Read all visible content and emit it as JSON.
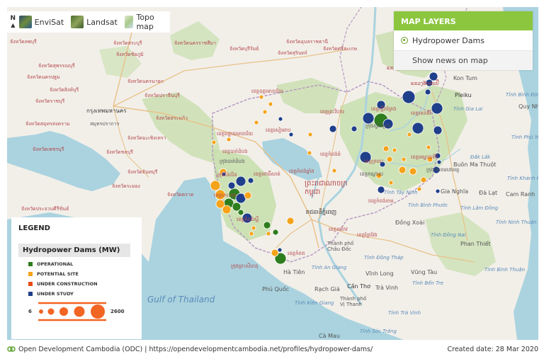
{
  "basemaps": [
    {
      "label": "EnviSat",
      "icon": "envisat-thumbnail"
    },
    {
      "label": "Landsat",
      "icon": "landsat-thumbnail"
    },
    {
      "label": "Topo map",
      "icon": "topo-thumbnail"
    }
  ],
  "north_label": "N",
  "layers_panel": {
    "title": "MAP LAYERS",
    "layer": "Hydropower Dams",
    "news": "Show news on map"
  },
  "legend": {
    "title": "LEGEND",
    "subtitle": "Hydropower Dams (MW)",
    "items": [
      {
        "label": "OPERATIONAL",
        "color": "#2e7d1e"
      },
      {
        "label": "POTENTIAL SITE",
        "color": "#f5a31a"
      },
      {
        "label": "UNDER CONSTRUCTION",
        "color": "#e84c1a"
      },
      {
        "label": "UNDER STUDY",
        "color": "#1f3f8a"
      }
    ],
    "scale_min": "6",
    "scale_max": "2600",
    "scale_color": "#f26522"
  },
  "footer": {
    "source": "Open Development Cambodia (ODC) | https://opendevelopmentcambodia.net/profiles/hydropower-dams/",
    "date": "Created date: 28 Mar 2020"
  },
  "map_labels": {
    "gulf": "Gulf of Thailand",
    "bangkok": "กรุงเทพมหานคร",
    "phnom_penh": "រាជធានីភ្នំពេញ",
    "cambodia": "ព្រះរាជាណាចក្រ\nកម្ពុជា",
    "ha_tien": "Hà Tiên",
    "phu_quoc": "Phú Quốc",
    "rach_gia": "Rạch Giá",
    "can_tho": "Cần Thơ",
    "vinh_long": "Vĩnh Long",
    "tra_vinh": "Trà Vinh",
    "vung_tau": "Vũng Tàu",
    "phan_thiet": "Phan Thiết",
    "pleiku": "Pleiku",
    "kon_tum": "Kon Tum",
    "quy_nhon": "Quy Nhơn",
    "buon_ma_thuot": "Buôn Ma Thuột",
    "gia_nghia": "Gia Nghĩa",
    "da_lat": "Đà Lạt",
    "cam_ranh": "Cam Ranh",
    "dong_xoai": "Đồng Xoài",
    "thanh_pho_chau_doc": "Thành phố Châu Đốc",
    "thanh_pho_vi_thanh": "Thành phố Vị Thanh",
    "ca_mau": "Cà Mau",
    "tinh_gia_lai": "Tỉnh Gia Lai",
    "tinh_binh_dinh": "Tỉnh Bình Định",
    "tinh_phu_yen": "Tỉnh Phú Yên",
    "dak_lak": "Đắk Lắk",
    "tinh_khanh_hoa": "Tỉnh Khánh Hòa",
    "tinh_ninh_thuan": "Tỉnh Ninh Thuận",
    "tinh_binh_thuan": "Tỉnh Bình Thuận",
    "tinh_lam_dong": "Tỉnh Lâm Đồng",
    "tinh_dong_nai": "Tỉnh Đồng Nai",
    "tinh_binh_phuoc": "Tỉnh Bình Phước",
    "tinh_kien_giang": "Tỉnh Kiên Giang",
    "tinh_soc_trang": "Tỉnh Sóc Trăng",
    "tinh_tra_vinh": "Tỉnh Trà Vinh",
    "tinh_ben_tre": "Tỉnh Bến Tre",
    "tinh_tay_ninh": "Tỉnh Tây Ninh",
    "tinh_an_giang": "Tỉnh An Giang",
    "tinh_dong_thap": "Tỉnh Đồng Tháp",
    "kon_tum_prov": "Tỉnh Kon Tum",
    "binh_dinh_city": "Bình Định",
    "lam_dong": "Tỉnh Lâm Đồng",
    "samut_prakan": "สมุทรปราการ",
    "th1": "จังหวัดลพบุรี",
    "th2": "จังหวัดสระบุรี",
    "th3": "จังหวัดนครนายก",
    "th4": "จังหวัดปราจีนบุรี",
    "th5": "จังหวัดสระแก้ว",
    "th6": "จังหวัดฉะเชิงเทรา",
    "th7": "จังหวัดชลบุรี",
    "th8": "จังหวัดระยอง",
    "th9": "จังหวัดจันทบุรี",
    "th10": "จังหวัดตราด",
    "th11": "จังหวัดนครราชสีมา",
    "th12": "จังหวัดบุรีรัมย์",
    "th13": "จังหวัดสุรินทร์",
    "th14": "จังหวัดศรีสะเกษ",
    "th15": "จังหวัดอุบลราชธานี",
    "th16": "จังหวัดอุดรธานี",
    "th17": "จังหวัดชัยภูมิ",
    "th18": "จังหวัดสุพรรณบุรี",
    "th19": "จังหวัดนครปฐม",
    "th20": "จังหวัดราชบุรี",
    "th21": "จังหวัดเพชรบุรี",
    "th22": "จังหวัดประจวบคีรีขันธ์",
    "th23": "จังหวัดสิงห์บุรี",
    "th24": "จังหวัดสมุทรสงคราม",
    "kh1": "ខេត្តឧត្តរមានជ័យ",
    "kh2": "ខេត្តព្រះវិហារ",
    "kh3": "ខេត្តស្ទឹងត្រែង",
    "kh4": "ខេត្តរតនគិរី",
    "kh5": "ខេត្តមណ្ឌលគិរី",
    "kh6": "ខេត្តក្រចេះ",
    "kh7": "ខេត្តកំពង់ធំ",
    "kh8": "ខេត្តសៀមរាប",
    "kh9": "ខេត្តបន្ទាយមានជ័យ",
    "kh10": "ខេត្តបាត់ដំបង",
    "kh11": "ក្រុងប៉ៃលិន",
    "kh12": "ខេត្តពោធិ៍សាត់",
    "kh13": "ខេត្តកំពង់ឆ្នាំង",
    "kh14": "ខេត្តកំពង់ស្ពឺ",
    "kh15": "ខេត្តកោះកុង",
    "kh16": "ខេត្តកំពត",
    "kh17": "ខេត្តតាកែវ",
    "kh18": "ខេត្តព្រៃវែង",
    "kh19": "ខេត្តស្វាយរៀង",
    "kh20": "ខេត្តកំពង់ចាម",
    "kh21": "ខេត្តត្បូងឃ្មុំ",
    "kh22": "ក្រុងព្រះសីហនុ",
    "kh23": "ខេត្តកែប",
    "kh24": "ក្រុងសែនមនោរម្យ",
    "kh25": "ក្រុងបាត់ដំបង",
    "kh26": "ក្រុងស្ទឹងត្រែង",
    "kh27": "ខេត្តកណ្ដាល",
    "la1": "ແຂວງຈຳປາສັກ",
    "la2": "ແຂວງອັດຕະປື",
    "la3": "ແຂວງເຊກອງ",
    "la4": "ແຂວງສາລະວັນ"
  },
  "dams": [
    {
      "s": "study",
      "c": [
        577,
        137
      ],
      "r": 9
    },
    {
      "s": "study",
      "c": [
        606,
        117
      ],
      "r": 5
    },
    {
      "s": "study",
      "c": [
        612,
        108
      ],
      "r": 6
    },
    {
      "s": "study",
      "c": [
        604,
        130
      ],
      "r": 4
    },
    {
      "s": "study",
      "c": [
        617,
        153
      ],
      "r": 8
    },
    {
      "s": "study",
      "c": [
        590,
        181
      ],
      "r": 8
    },
    {
      "s": "study",
      "c": [
        618,
        184
      ],
      "r": 6
    },
    {
      "s": "op",
      "c": [
        538,
        170
      ],
      "r": 10
    },
    {
      "s": "study",
      "c": [
        520,
        167
      ],
      "r": 8
    },
    {
      "s": "study",
      "c": [
        548,
        175
      ],
      "r": 7
    },
    {
      "s": "study",
      "c": [
        538,
        148
      ],
      "r": 6
    },
    {
      "s": "study",
      "c": [
        500,
        182
      ],
      "r": 4
    },
    {
      "s": "study",
      "c": [
        470,
        182
      ],
      "r": 5
    },
    {
      "s": "study",
      "c": [
        516,
        222
      ],
      "r": 8
    },
    {
      "s": "study",
      "c": [
        540,
        232
      ],
      "r": 4
    },
    {
      "s": "study",
      "c": [
        618,
        220
      ],
      "r": 4
    },
    {
      "s": "study",
      "c": [
        616,
        240
      ],
      "r": 5
    },
    {
      "s": "study",
      "c": [
        620,
        229
      ],
      "r": 3
    },
    {
      "s": "study",
      "c": [
        538,
        268
      ],
      "r": 5
    },
    {
      "s": "pot",
      "c": [
        545,
        210
      ],
      "r": 4
    },
    {
      "s": "pot",
      "c": [
        557,
        212
      ],
      "r": 3
    },
    {
      "s": "pot",
      "c": [
        550,
        225
      ],
      "r": 4
    },
    {
      "s": "pot",
      "c": [
        535,
        248
      ],
      "r": 4
    },
    {
      "s": "pot",
      "c": [
        568,
        240
      ],
      "r": 5
    },
    {
      "s": "pot",
      "c": [
        583,
        242
      ],
      "r": 5
    },
    {
      "s": "pot",
      "c": [
        598,
        254
      ],
      "r": 4
    },
    {
      "s": "pot",
      "c": [
        607,
        225
      ],
      "r": 4
    },
    {
      "s": "pot",
      "c": [
        605,
        208
      ],
      "r": 3
    },
    {
      "s": "pot",
      "c": [
        570,
        225
      ],
      "r": 3
    },
    {
      "s": "pot",
      "c": [
        552,
        258
      ],
      "r": 3
    },
    {
      "s": "pot",
      "c": [
        472,
        241
      ],
      "r": 3
    },
    {
      "s": "pot",
      "c": [
        437,
        216
      ],
      "r": 3
    },
    {
      "s": "pot",
      "c": [
        438,
        190
      ],
      "r": 3
    },
    {
      "s": "pot",
      "c": [
        369,
        137
      ],
      "r": 3
    },
    {
      "s": "pot",
      "c": [
        382,
        147
      ],
      "r": 3
    },
    {
      "s": "pot",
      "c": [
        374,
        158
      ],
      "r": 3
    },
    {
      "s": "study",
      "c": [
        396,
        168
      ],
      "r": 3
    },
    {
      "s": "study",
      "c": [
        411,
        190
      ],
      "r": 3
    },
    {
      "s": "pot",
      "c": [
        362,
        173
      ],
      "r": 3
    },
    {
      "s": "pot",
      "c": [
        302,
        201
      ],
      "r": 3
    },
    {
      "s": "pot",
      "c": [
        323,
        197
      ],
      "r": 3
    },
    {
      "s": "pot",
      "c": [
        315,
        243
      ],
      "r": 5
    },
    {
      "s": "study",
      "c": [
        316,
        246
      ],
      "r": 3
    },
    {
      "s": "pot",
      "c": [
        304,
        262
      ],
      "r": 7
    },
    {
      "s": "pot",
      "c": [
        311,
        275
      ],
      "r": 7
    },
    {
      "s": "pot",
      "c": [
        311,
        288
      ],
      "r": 6
    },
    {
      "s": "pot",
      "c": [
        320,
        296
      ],
      "r": 6
    },
    {
      "s": "op",
      "c": [
        323,
        287
      ],
      "r": 7
    },
    {
      "s": "op",
      "c": [
        331,
        274
      ],
      "r": 8
    },
    {
      "s": "op",
      "c": [
        334,
        292
      ],
      "r": 6
    },
    {
      "s": "study",
      "c": [
        340,
        256
      ],
      "r": 7
    },
    {
      "s": "study",
      "c": [
        340,
        280
      ],
      "r": 7
    },
    {
      "s": "study",
      "c": [
        349,
        308
      ],
      "r": 7
    },
    {
      "s": "study",
      "c": [
        327,
        262
      ],
      "r": 5
    },
    {
      "s": "op",
      "c": [
        340,
        300
      ],
      "r": 4
    },
    {
      "s": "pot",
      "c": [
        350,
        276
      ],
      "r": 5
    },
    {
      "s": "study",
      "c": [
        354,
        255
      ],
      "r": 4
    },
    {
      "s": "pot",
      "c": [
        358,
        322
      ],
      "r": 3
    },
    {
      "s": "op",
      "c": [
        377,
        318
      ],
      "r": 5
    },
    {
      "s": "op",
      "c": [
        389,
        328
      ],
      "r": 4
    },
    {
      "s": "pot",
      "c": [
        379,
        330
      ],
      "r": 3
    },
    {
      "s": "pot",
      "c": [
        410,
        312
      ],
      "r": 5
    },
    {
      "s": "pot",
      "c": [
        388,
        357
      ],
      "r": 5
    },
    {
      "s": "op",
      "c": [
        396,
        365
      ],
      "r": 8
    },
    {
      "s": "study",
      "c": [
        395,
        353
      ],
      "r": 3
    },
    {
      "s": "pot",
      "c": [
        355,
        330
      ],
      "r": 3
    },
    {
      "s": "pot",
      "c": [
        578,
        190
      ],
      "r": 3
    },
    {
      "s": "pot",
      "c": [
        592,
        267
      ],
      "r": 3
    },
    {
      "s": "study",
      "c": [
        618,
        270
      ],
      "r": 3
    }
  ]
}
